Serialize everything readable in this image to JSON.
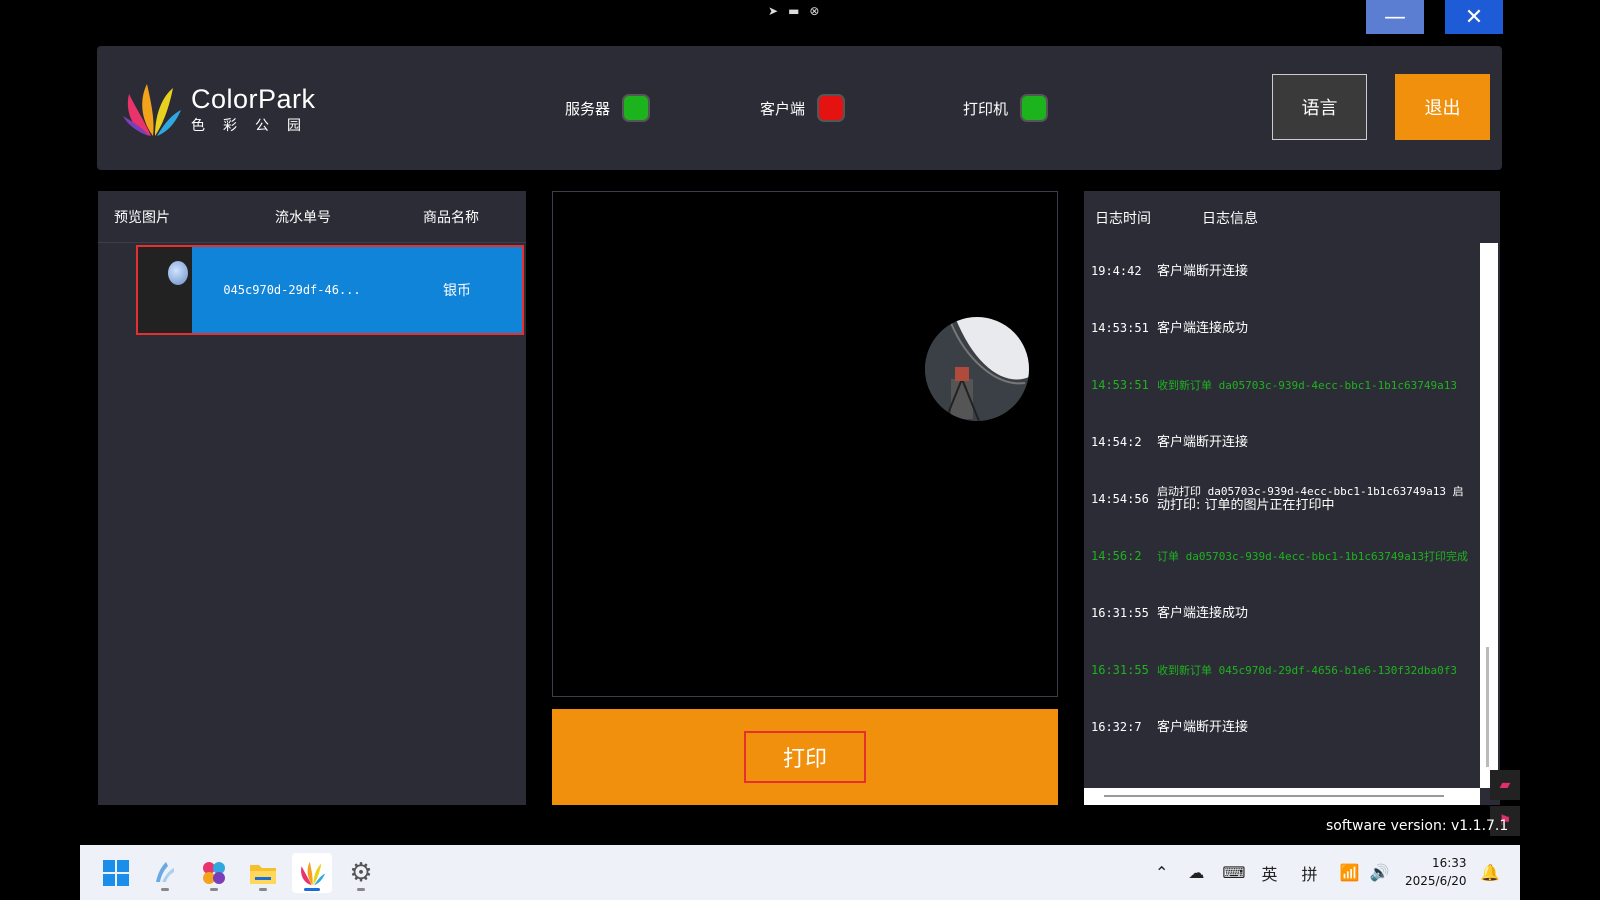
{
  "window": {
    "minimize_icon": "minimize-icon",
    "close_icon": "close-icon",
    "top_icons": [
      "send-icon",
      "keyboard-icon",
      "close-circle-icon"
    ]
  },
  "header": {
    "logo_en": "ColorPark",
    "logo_cn": "色彩公园",
    "status": [
      {
        "label": "服务器",
        "color": "#1db31d"
      },
      {
        "label": "客户端",
        "color": "#e51212"
      },
      {
        "label": "打印机",
        "color": "#1db31d"
      }
    ],
    "language_button": "语言",
    "exit_button": "退出"
  },
  "orders": {
    "columns": [
      "预览图片",
      "流水单号",
      "商品名称"
    ],
    "rows": [
      {
        "id": "045c970d-29df-46...",
        "name": "银币"
      }
    ]
  },
  "print_button": "打印",
  "log": {
    "columns": [
      "日志时间",
      "日志信息"
    ],
    "items": [
      {
        "time": "19:4:42",
        "msg": "客户端断开连接",
        "color": "white"
      },
      {
        "time": "14:53:51",
        "msg": "客户端连接成功",
        "color": "white"
      },
      {
        "time": "14:53:51",
        "msg": "收到新订单 da05703c-939d-4ecc-bbc1-1b1c63749a13",
        "color": "green"
      },
      {
        "time": "14:54:2",
        "msg": "客户端断开连接",
        "color": "white"
      },
      {
        "time": "14:54:56",
        "msg": " 启动打印 da05703c-939d-4ecc-bbc1-1b1c63749a13 启",
        "msg2": "动打印: 订单的图片正在打印中",
        "color": "white"
      },
      {
        "time": "14:56:2",
        "msg": "订单 da05703c-939d-4ecc-bbc1-1b1c63749a13打印完成",
        "color": "green"
      },
      {
        "time": "16:31:55",
        "msg": "客户端连接成功",
        "color": "white"
      },
      {
        "time": "16:31:55",
        "msg": "收到新订单 045c970d-29df-4656-b1e6-130f32dba0f3",
        "color": "green"
      },
      {
        "time": "16:32:7",
        "msg": "客户端断开连接",
        "color": "white"
      }
    ]
  },
  "version": "software version: v1.1.7.1",
  "taskbar": {
    "apps": [
      "windows-start-icon",
      "colorpark-client-icon",
      "palette-app-icon",
      "file-explorer-icon",
      "colorpark-app-icon",
      "settings-icon"
    ],
    "tray": {
      "ime_lang": "英",
      "ime_mode": "拼",
      "time": "16:33",
      "date": "2025/6/20"
    }
  }
}
